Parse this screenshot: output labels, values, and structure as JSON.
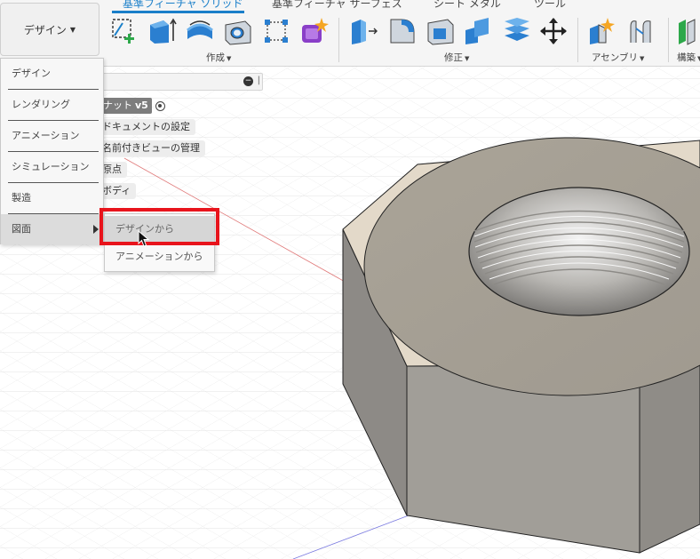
{
  "toolbar": {
    "workspace_label": "デザイン",
    "tabs": [
      {
        "label": "基準フィーチャ ソリッド",
        "active": true
      },
      {
        "label": "基準フィーチャ サーフェス",
        "active": false
      },
      {
        "label": "シート メタル",
        "active": false
      },
      {
        "label": "ツール",
        "active": false
      }
    ],
    "groups": {
      "create": "作成",
      "modify": "修正",
      "assemble": "アセンブリ",
      "construct": "構築"
    },
    "tools": {
      "create": [
        "create-sketch-icon",
        "extrude-icon",
        "revolve-icon",
        "hole-icon",
        "pattern-icon",
        "create-form-icon"
      ],
      "modify": [
        "press-pull-icon",
        "fillet-icon",
        "shell-icon",
        "combine-icon",
        "offset-face-icon",
        "move-icon"
      ],
      "assemble": [
        "new-component-icon",
        "joint-icon"
      ],
      "construct": [
        "offset-plane-icon"
      ]
    },
    "accent_color": "#1a7fc9"
  },
  "browser": {
    "root_name": "ナット",
    "root_version": "v5",
    "items": [
      "ドキュメントの設定",
      "名前付きビューの管理",
      "原点",
      "ボディ"
    ]
  },
  "workspace_menu": {
    "items": [
      "デザイン",
      "レンダリング",
      "アニメーション",
      "シミュレーション",
      "製造",
      "図面"
    ],
    "hovered": "図面"
  },
  "drawing_submenu": {
    "items": [
      "デザインから",
      "アニメーションから"
    ],
    "hovered": "デザインから"
  },
  "highlight": {
    "color": "#e8141c"
  },
  "model": {
    "face_color": "#a6a097",
    "side_color": "#9c9994",
    "chamfer_color": "#e3d9c9"
  }
}
